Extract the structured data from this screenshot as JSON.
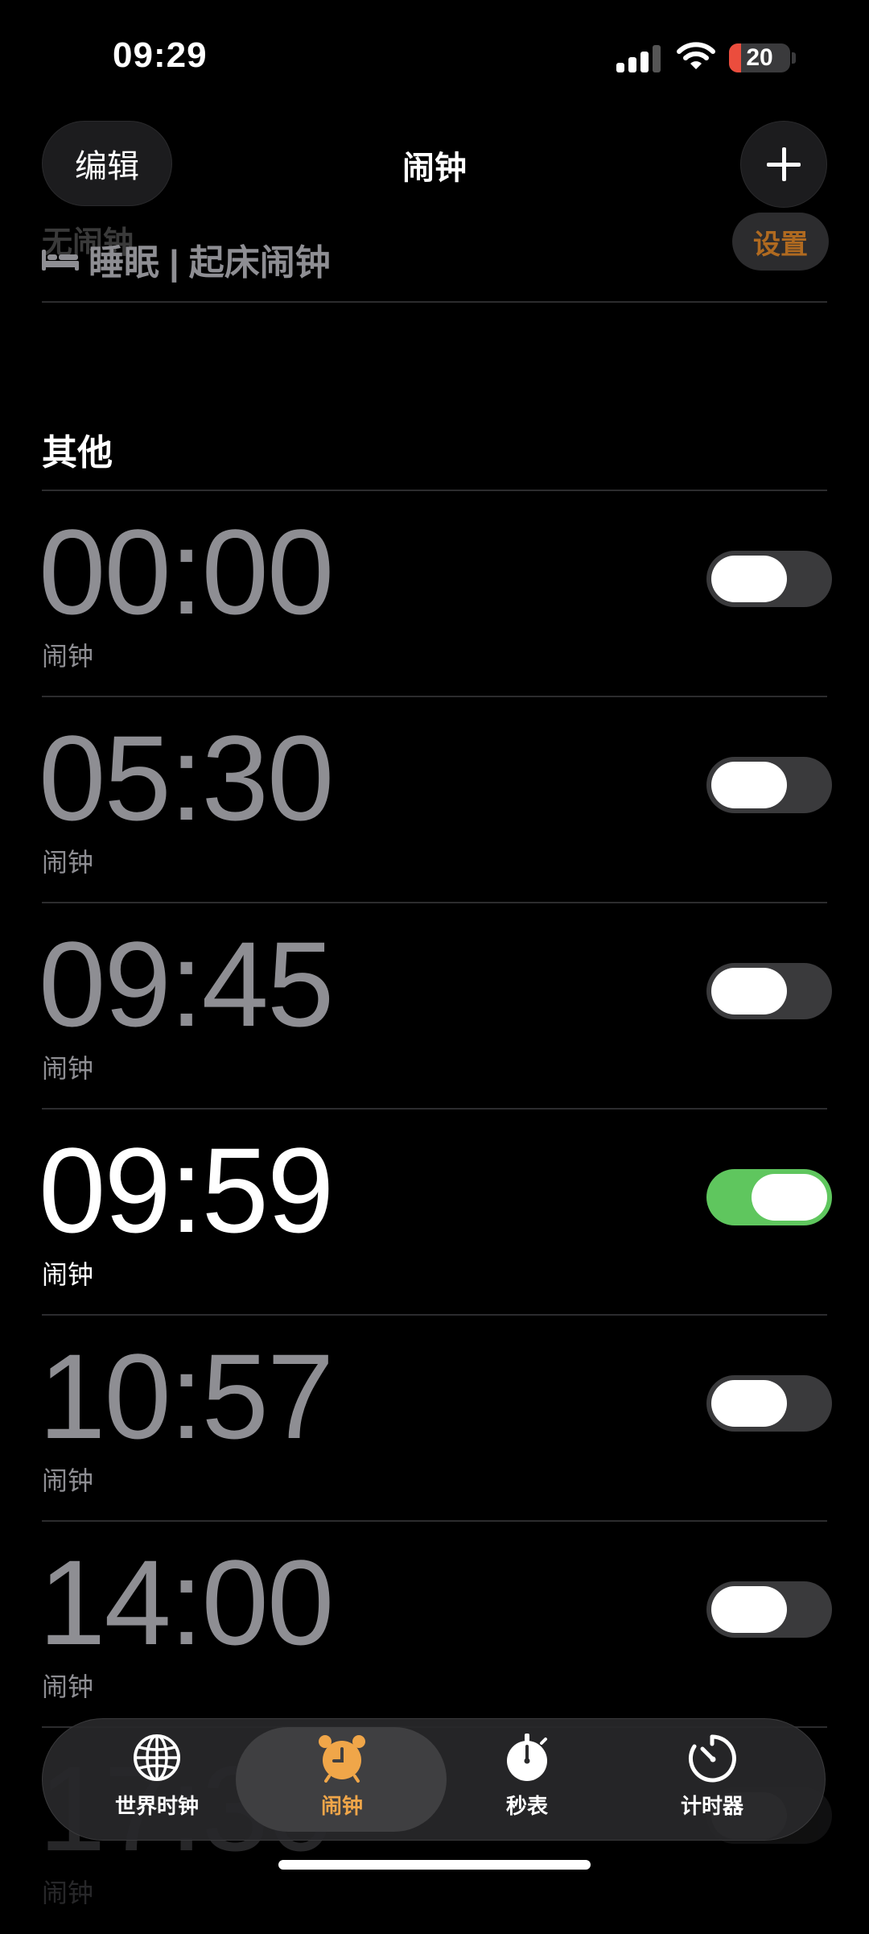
{
  "status_bar": {
    "time": "09:29",
    "battery_level": "20"
  },
  "nav": {
    "edit_label": "编辑",
    "title": "闹钟",
    "add_icon": "plus-icon"
  },
  "sleep": {
    "ghost_label": "无闹钟",
    "label": "睡眠 | 起床闹钟",
    "icon": "bed-icon",
    "set_label": "设置"
  },
  "other_section": {
    "title": "其他"
  },
  "alarms": [
    {
      "time": "00:00",
      "label": "闹钟",
      "enabled": false
    },
    {
      "time": "05:30",
      "label": "闹钟",
      "enabled": false
    },
    {
      "time": "09:45",
      "label": "闹钟",
      "enabled": false
    },
    {
      "time": "09:59",
      "label": "闹钟",
      "enabled": true
    },
    {
      "time": "10:57",
      "label": "闹钟",
      "enabled": false
    },
    {
      "time": "14:00",
      "label": "闹钟",
      "enabled": false
    },
    {
      "time": "17:30",
      "label": "闹钟",
      "enabled": false
    }
  ],
  "tabs": [
    {
      "label": "世界时钟",
      "icon": "globe-icon",
      "active": false
    },
    {
      "label": "闹钟",
      "icon": "alarm-clock-icon",
      "active": true
    },
    {
      "label": "秒表",
      "icon": "stopwatch-icon",
      "active": false
    },
    {
      "label": "计时器",
      "icon": "timer-icon",
      "active": false
    }
  ],
  "colors": {
    "accent": "#f0a649",
    "toggle_on": "#5fc65e",
    "set_button_text": "#b06a20"
  }
}
